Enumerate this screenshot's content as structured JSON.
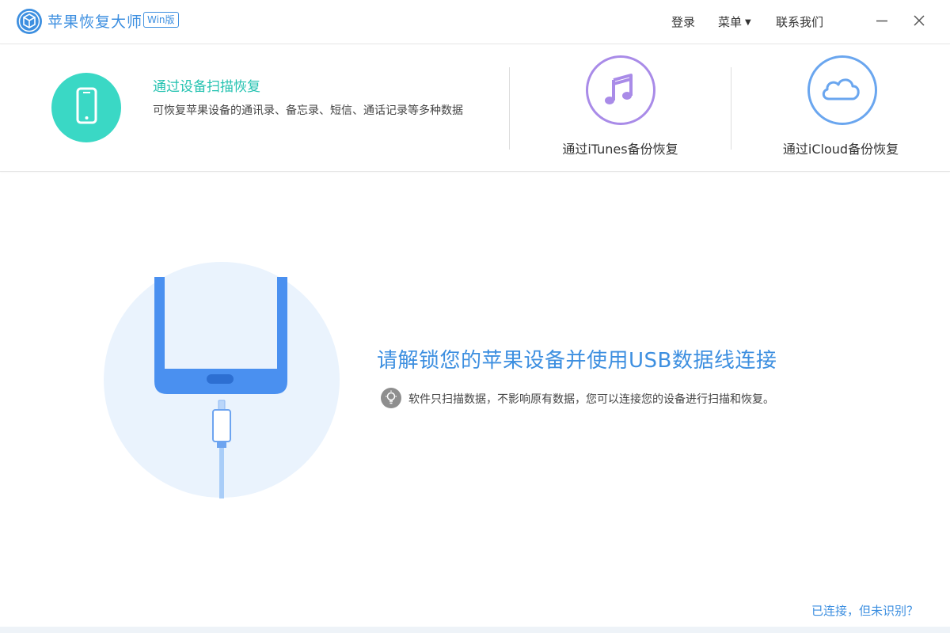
{
  "app": {
    "title": "苹果恢复大师",
    "edition": "Win版"
  },
  "header": {
    "login_label": "登录",
    "menu_label": "菜单",
    "contact_label": "联系我们"
  },
  "modes": {
    "scan": {
      "title": "通过设备扫描恢复",
      "description": "可恢复苹果设备的通讯录、备忘录、短信、通话记录等多种数据",
      "icon": "phone-icon"
    },
    "itunes": {
      "label": "通过iTunes备份恢复",
      "icon": "music-note-icon"
    },
    "icloud": {
      "label": "通过iCloud备份恢复",
      "icon": "cloud-icon"
    }
  },
  "main": {
    "title": "请解锁您的苹果设备并使用USB数据线连接",
    "tip": "软件只扫描数据，不影响原有数据，您可以连接您的设备进行扫描和恢复。",
    "tip_icon": "lightbulb-icon",
    "help_link": "已连接，但未识别？"
  },
  "colors": {
    "accent": "#3d8fe0",
    "scan_teal": "#3ad8c5",
    "itunes_purple": "#a98be8",
    "icloud_blue": "#6aa6ef",
    "phone_blue": "#4a90f0"
  }
}
